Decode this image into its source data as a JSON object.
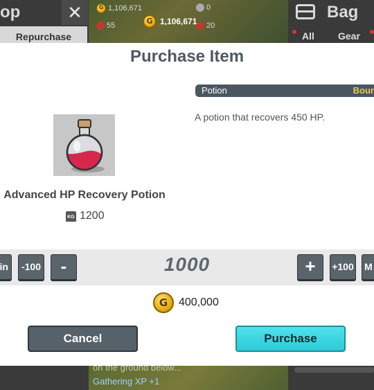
{
  "background": {
    "shop_title": "op",
    "close_glyph": "✕",
    "repurchase_tab": "Repurchase",
    "stats": {
      "gold_small": "1,106,671",
      "stat_a": "55",
      "stat_b": "0",
      "stat_c": "20"
    },
    "gold_total": "1,106,671",
    "bag_title": "Bag",
    "bag_tabs": [
      "All",
      "Gear"
    ],
    "log_lines": [
      "on the ground below...",
      "Gathering XP +1"
    ]
  },
  "dialog": {
    "title": "Purchase Item",
    "item": {
      "name": "Advanced HP Recovery Potion",
      "weight": "1200",
      "category": "Potion",
      "binding": "Bour",
      "description": "A potion that recovers 450 HP.",
      "icon": "potion-icon"
    },
    "quantity": {
      "min_label": "in",
      "minus100_label": "-100",
      "minus_label": "-",
      "value": "1000",
      "plus_label": "+",
      "plus100_label": "+100",
      "max_label": "M"
    },
    "price": "400,000",
    "cancel_label": "Cancel",
    "purchase_label": "Purchase"
  },
  "colors": {
    "accent": "#2ccad6",
    "dark_button": "#56616a",
    "category_bar": "#4a5761",
    "gold": "#e0a400"
  }
}
